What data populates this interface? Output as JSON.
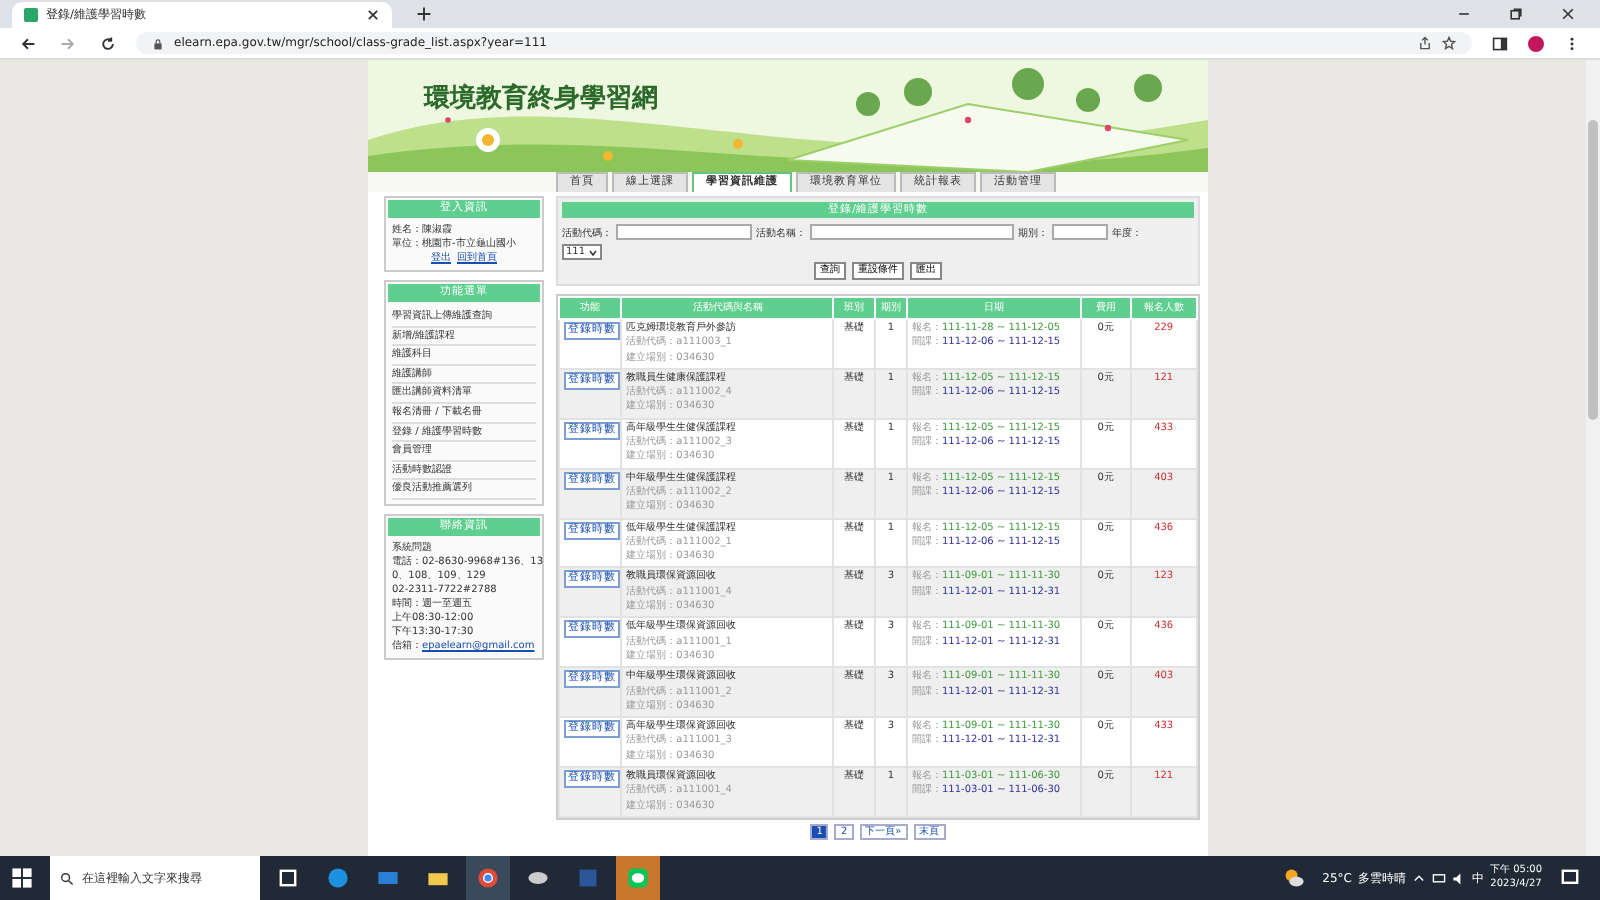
{
  "browser": {
    "tab_title": "登錄/維護學習時數",
    "url": "elearn.epa.gov.tw/mgr/school/class-grade_list.aspx?year=111"
  },
  "banner": {
    "site_title": "環境教育終身學習網"
  },
  "nav_tabs": [
    {
      "label": "首頁",
      "selected": false
    },
    {
      "label": "線上選課",
      "selected": false
    },
    {
      "label": "學習資訊維護",
      "selected": true
    },
    {
      "label": "環境教育單位",
      "selected": false
    },
    {
      "label": "統計報表",
      "selected": false
    },
    {
      "label": "活動管理",
      "selected": false
    }
  ],
  "sidebar": {
    "login": {
      "title": "登入資訊",
      "lines": [
        "姓名：陳淑霞",
        "單位：桃園市-市立龜山國小"
      ],
      "links": [
        "登出",
        "回到首頁"
      ]
    },
    "menu": {
      "title": "功能選單",
      "items": [
        "學習資訊上傳維護查詢",
        "新增/維護課程",
        "維護科目",
        "維護講師",
        "匯出講師資料清單",
        "報名清冊 / 下載名冊",
        "登錄 / 維護學習時數",
        "會員管理",
        "活動時數認證",
        "優良活動推薦選列"
      ]
    },
    "contact": {
      "title": "聯絡資訊",
      "lines": [
        "系統問題",
        "電話：02-8630-9968#136、13",
        "0、108、109、129",
        "02-2311-7722#2788",
        "時間：週一至週五",
        "上午08:30-12:00",
        "下午13:30-17:30"
      ],
      "email_label": "信箱：",
      "email": "epaelearn@gmail.com"
    }
  },
  "search": {
    "title": "登錄/維護學習時數",
    "code_label": "活動代碼：",
    "name_label": "活動名稱：",
    "term_label": "期別：",
    "year_label": "年度：",
    "year_value": "111",
    "buttons": [
      "查詢",
      "重設條件",
      "匯出"
    ]
  },
  "table": {
    "columns": [
      "功能",
      "活動代碼與名稱",
      "班別",
      "期別",
      "日期",
      "費用",
      "報名人數"
    ],
    "rows": [
      {
        "action": "登錄時數",
        "name": "匹克姆環境教育戶外參訪",
        "code": "活動代碼：a111003_1",
        "site": "建立場別：034630",
        "level": "基礎",
        "term": "1",
        "signup_label": "報名：",
        "signup": "111-11-28 ~ 111-12-05",
        "course_label": "開課：",
        "course": "111-12-06 ~ 111-12-15",
        "fee": "0元",
        "count": "229"
      },
      {
        "action": "登錄時數",
        "name": "教職員生健康保護課程",
        "code": "活動代碼：a111002_4",
        "site": "建立場別：034630",
        "level": "基礎",
        "term": "1",
        "signup_label": "報名：",
        "signup": "111-12-05 ~ 111-12-15",
        "course_label": "開課：",
        "course": "111-12-06 ~ 111-12-15",
        "fee": "0元",
        "count": "121"
      },
      {
        "action": "登錄時數",
        "name": "高年級學生生健保護課程",
        "code": "活動代碼：a111002_3",
        "site": "建立場別：034630",
        "level": "基礎",
        "term": "1",
        "signup_label": "報名：",
        "signup": "111-12-05 ~ 111-12-15",
        "course_label": "開課：",
        "course": "111-12-06 ~ 111-12-15",
        "fee": "0元",
        "count": "433"
      },
      {
        "action": "登錄時數",
        "name": "中年級學生生健保護課程",
        "code": "活動代碼：a111002_2",
        "site": "建立場別：034630",
        "level": "基礎",
        "term": "1",
        "signup_label": "報名：",
        "signup": "111-12-05 ~ 111-12-15",
        "course_label": "開課：",
        "course": "111-12-06 ~ 111-12-15",
        "fee": "0元",
        "count": "403"
      },
      {
        "action": "登錄時數",
        "name": "低年級學生生健保護課程",
        "code": "活動代碼：a111002_1",
        "site": "建立場別：034630",
        "level": "基礎",
        "term": "1",
        "signup_label": "報名：",
        "signup": "111-12-05 ~ 111-12-15",
        "course_label": "開課：",
        "course": "111-12-06 ~ 111-12-15",
        "fee": "0元",
        "count": "436"
      },
      {
        "action": "登錄時數",
        "name": "教職員環保資源回收",
        "code": "活動代碼：a111001_4",
        "site": "建立場別：034630",
        "level": "基礎",
        "term": "3",
        "signup_label": "報名：",
        "signup": "111-09-01 ~ 111-11-30",
        "course_label": "開課：",
        "course": "111-12-01 ~ 111-12-31",
        "fee": "0元",
        "count": "123"
      },
      {
        "action": "登錄時數",
        "name": "低年級學生環保資源回收",
        "code": "活動代碼：a111001_1",
        "site": "建立場別：034630",
        "level": "基礎",
        "term": "3",
        "signup_label": "報名：",
        "signup": "111-09-01 ~ 111-11-30",
        "course_label": "開課：",
        "course": "111-12-01 ~ 111-12-31",
        "fee": "0元",
        "count": "436"
      },
      {
        "action": "登錄時數",
        "name": "中年級學生環保資源回收",
        "code": "活動代碼：a111001_2",
        "site": "建立場別：034630",
        "level": "基礎",
        "term": "3",
        "signup_label": "報名：",
        "signup": "111-09-01 ~ 111-11-30",
        "course_label": "開課：",
        "course": "111-12-01 ~ 111-12-31",
        "fee": "0元",
        "count": "403"
      },
      {
        "action": "登錄時數",
        "name": "高年級學生環保資源回收",
        "code": "活動代碼：a111001_3",
        "site": "建立場別：034630",
        "level": "基礎",
        "term": "3",
        "signup_label": "報名：",
        "signup": "111-09-01 ~ 111-11-30",
        "course_label": "開課：",
        "course": "111-12-01 ~ 111-12-31",
        "fee": "0元",
        "count": "433"
      },
      {
        "action": "登錄時數",
        "name": "教職員環保資源回收",
        "code": "活動代碼：a111001_4",
        "site": "建立場別：034630",
        "level": "基礎",
        "term": "1",
        "signup_label": "報名：",
        "signup": "111-03-01 ~ 111-06-30",
        "course_label": "開課：",
        "course": "111-03-01 ~ 111-06-30",
        "fee": "0元",
        "count": "121"
      }
    ]
  },
  "pagination": [
    {
      "label": "1",
      "selected": true
    },
    {
      "label": "2",
      "selected": false
    },
    {
      "label": "下一頁»",
      "selected": false
    },
    {
      "label": "末頁",
      "selected": false
    }
  ],
  "taskbar": {
    "search_placeholder": "在這裡輸入文字來搜尋",
    "temperature": "25°C",
    "weather": "多雲時晴",
    "ime": "中",
    "time": "下午 05:00",
    "date": "2023/4/27"
  }
}
